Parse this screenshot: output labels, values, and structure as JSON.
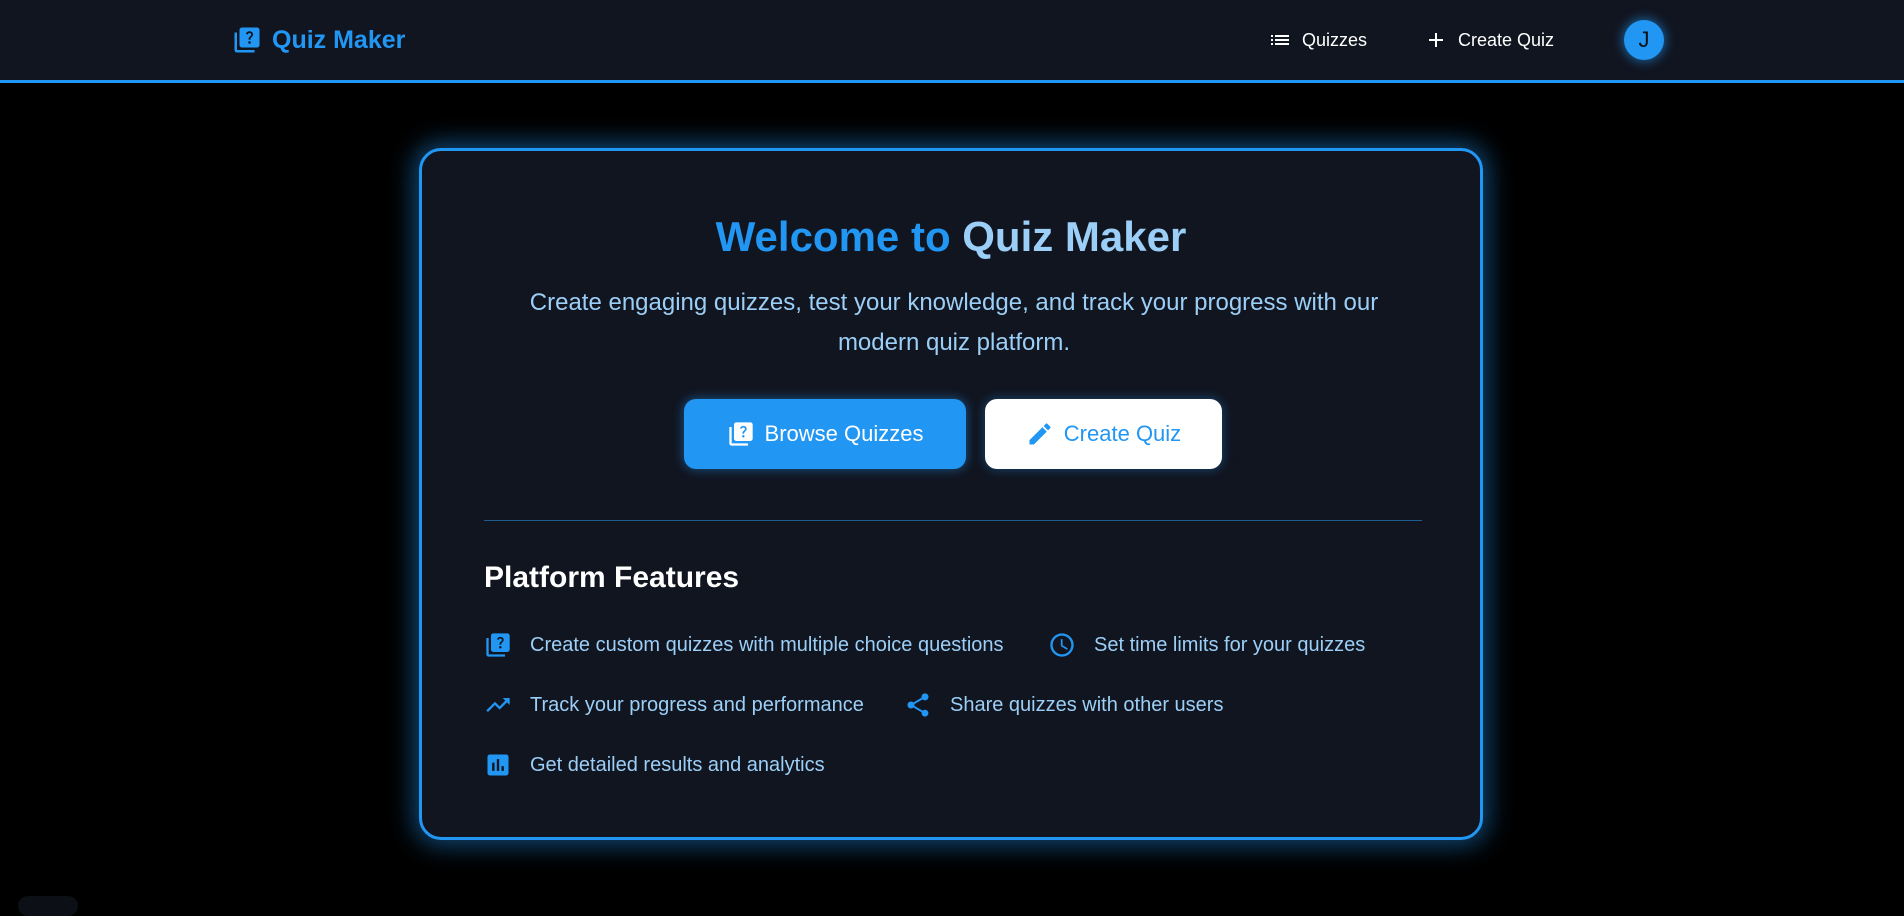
{
  "colors": {
    "accent": "#2196f3",
    "accent_light": "#9ccff7",
    "panel_bg": "#111520",
    "page_bg": "#000000"
  },
  "navbar": {
    "brand_icon": "quiz-icon",
    "brand": "Quiz Maker",
    "links": [
      {
        "icon": "list-icon",
        "label": "Quizzes"
      },
      {
        "icon": "plus-icon",
        "label": "Create Quiz"
      }
    ],
    "avatar_letter": "J"
  },
  "hero": {
    "title_accent": "Welcome to",
    "title_rest": "Quiz Maker",
    "subtitle": "Create engaging quizzes, test your knowledge, and track your progress with our modern quiz platform.",
    "buttons": [
      {
        "icon": "quiz-icon",
        "label": "Browse Quizzes"
      },
      {
        "icon": "pencil-icon",
        "label": "Create Quiz"
      }
    ]
  },
  "features": {
    "title": "Platform Features",
    "items": [
      {
        "icon": "quiz-icon",
        "text": "Create custom quizzes with multiple choice questions"
      },
      {
        "icon": "clock-icon",
        "text": "Set time limits for your quizzes"
      },
      {
        "icon": "trending-up-icon",
        "text": "Track your progress and performance"
      },
      {
        "icon": "share-icon",
        "text": "Share quizzes with other users"
      },
      {
        "icon": "bar-chart-icon",
        "text": "Get detailed results and analytics"
      }
    ]
  }
}
